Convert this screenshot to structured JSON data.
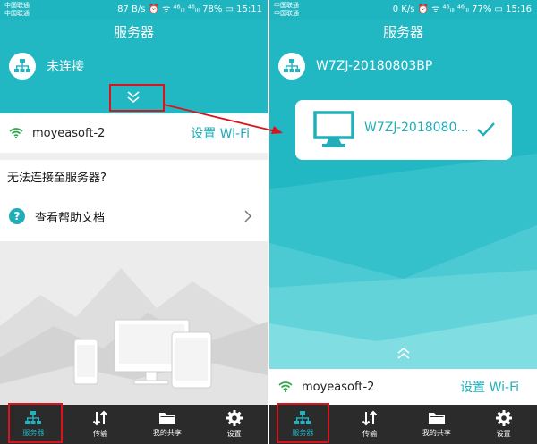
{
  "colors": {
    "accent": "#1fb5c0",
    "highlight": "#d9141c",
    "tab_bar": "#2b2b2b"
  },
  "screen_left": {
    "status_bar": {
      "carrier_1": "中国联通",
      "carrier_2": "中国联通",
      "right_text": "87 B/s ⏰ ᯤ ⁴⁶ᵢₗₗ ⁴⁶ᵢₗₗ 78% ▭ 15:11"
    },
    "title": "服务器",
    "server_status": "未连接",
    "wifi": {
      "ssid": "moyeasoft-2",
      "setup_label": "设置 Wi-Fi"
    },
    "help": {
      "title": "无法连接至服务器?",
      "link_label": "查看帮助文档",
      "icon_char": "?"
    }
  },
  "screen_right": {
    "status_bar": {
      "carrier_1": "中国联通",
      "carrier_2": "中国联通",
      "right_text": "0 K/s ⏰ ᯤ ⁴⁶ᵢₗₗ ⁴⁶ᵢₗₗ 77% ▭ 15:16"
    },
    "title": "服务器",
    "server_name": "W7ZJ-20180803BP",
    "device_card": {
      "name": "W7ZJ-2018080...",
      "icon": "monitor-icon",
      "status_icon": "checkmark-icon"
    },
    "wifi": {
      "ssid": "moyeasoft-2",
      "setup_label": "设置 Wi-Fi"
    }
  },
  "tabs": [
    {
      "label": "服务器",
      "icon": "server-network-icon",
      "active": true
    },
    {
      "label": "传输",
      "icon": "transfer-arrows-icon",
      "active": false
    },
    {
      "label": "我的共享",
      "icon": "folder-icon",
      "active": false
    },
    {
      "label": "设置",
      "icon": "gear-icon",
      "active": false
    }
  ]
}
